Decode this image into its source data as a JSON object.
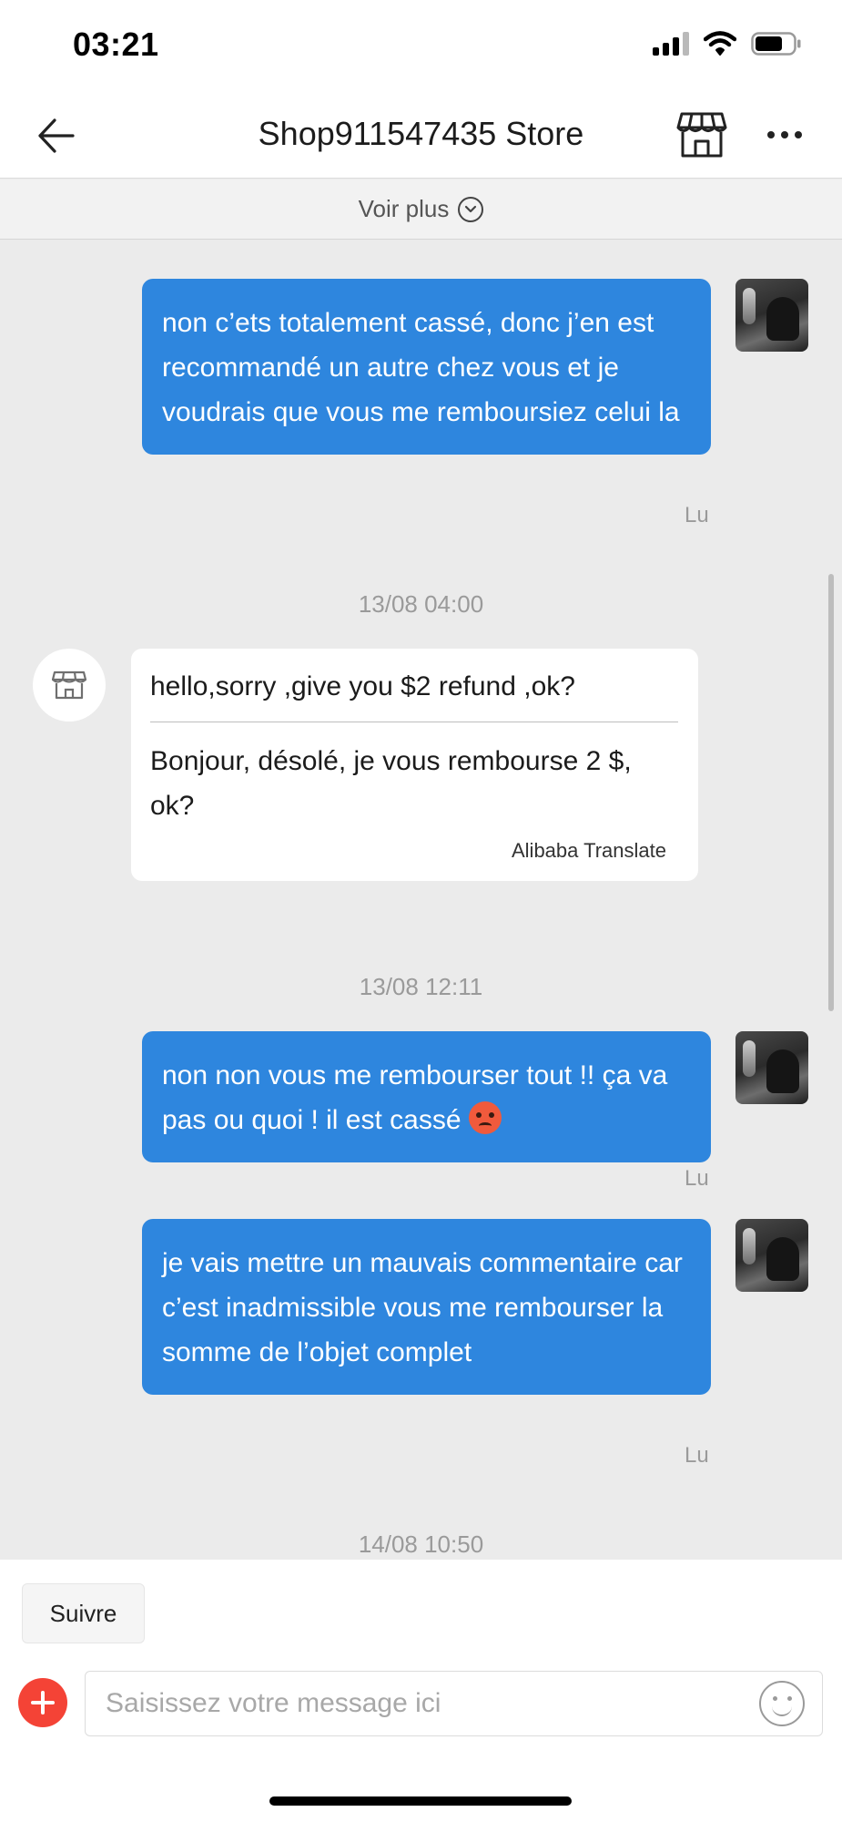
{
  "status_bar": {
    "time": "03:21",
    "icons": [
      "cellular-signal-icon",
      "wifi-icon",
      "battery-icon"
    ]
  },
  "header": {
    "title": "Shop911547435 Store",
    "back_icon": "arrow-left-icon",
    "store_icon": "storefront-icon",
    "more_icon": "more-horizontal-icon"
  },
  "voir_plus": {
    "label": "Voir plus",
    "icon": "chevron-down-circle-icon"
  },
  "messages": [
    {
      "kind": "outgoing",
      "text": "non c’ets totalement cassé, donc j’en est recommandé un autre chez vous et je voudrais que vous me remboursiez celui la",
      "status": "Lu"
    },
    {
      "kind": "timestamp",
      "text": "13/08 04:00"
    },
    {
      "kind": "incoming",
      "original": "hello,sorry ,give you $2 refund ,ok?",
      "translation": "Bonjour, désolé, je vous rembourse 2 $, ok?",
      "credit": "Alibaba Translate"
    },
    {
      "kind": "timestamp",
      "text": "13/08 12:11"
    },
    {
      "kind": "outgoing",
      "text": "non non vous me rembourser tout !!  ça va pas ou quoi ! il est cassé",
      "emoji": "angry-face-emoji",
      "status": "Lu"
    },
    {
      "kind": "outgoing",
      "text": "je vais mettre un mauvais commentaire car c’est inadmissible vous me rembourser la somme de l’objet complet",
      "status": "Lu"
    },
    {
      "kind": "timestamp",
      "text": "14/08 10:50"
    }
  ],
  "bottom": {
    "follow_label": "Suivre",
    "input_placeholder": "Saisissez votre message ici",
    "input_value": "",
    "add_icon": "plus-circle-icon",
    "emoji_icon": "smiley-icon"
  },
  "colors": {
    "outgoing_bubble": "#2e86de",
    "incoming_bubble": "#ffffff",
    "chat_background": "#ebebeb",
    "add_button": "#f44336"
  }
}
